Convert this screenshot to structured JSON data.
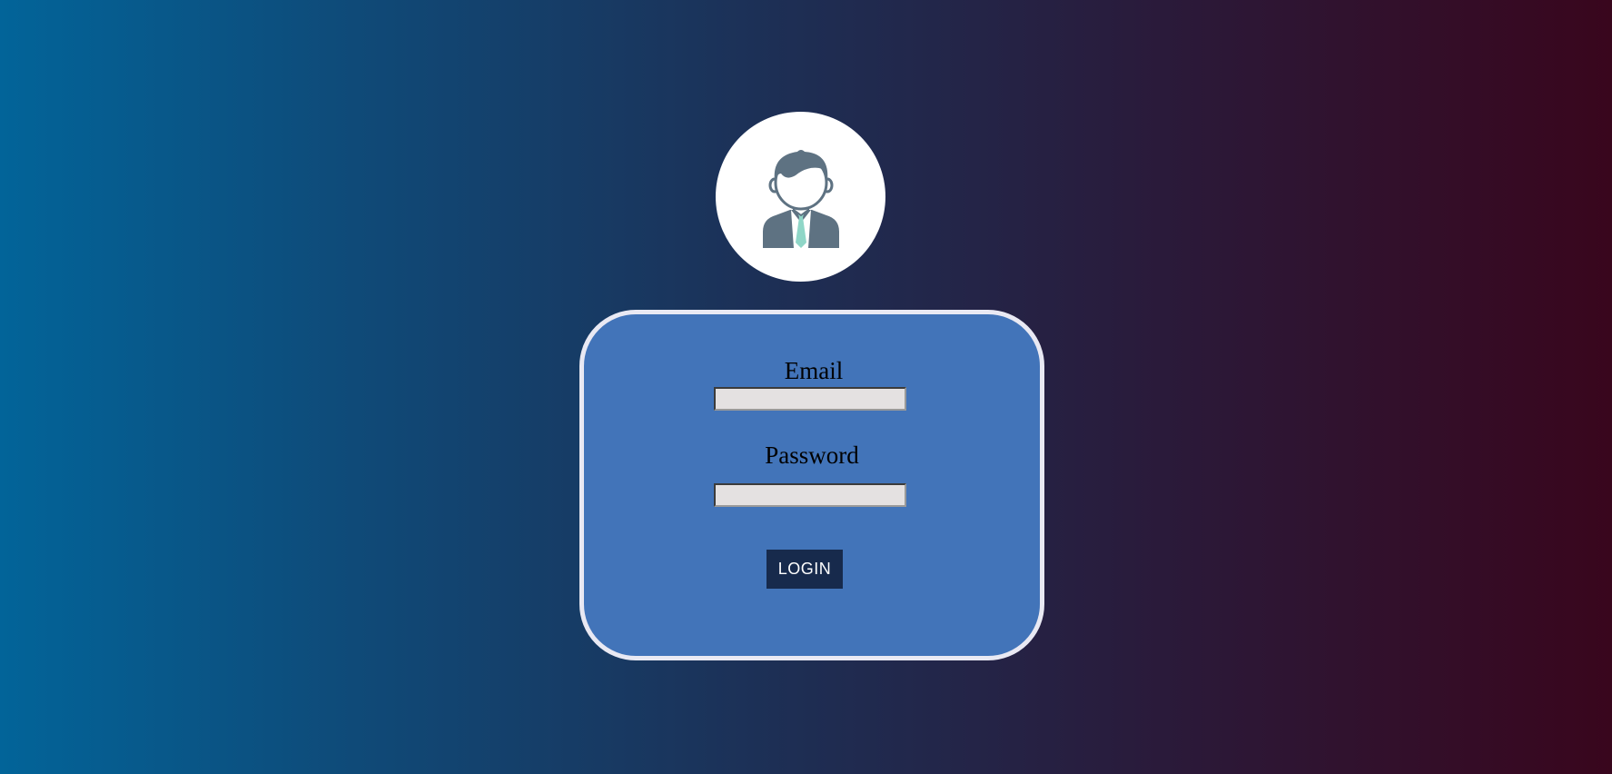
{
  "colors": {
    "card_background": "#4274b9",
    "card_border": "#e9e9f3",
    "button_background": "#172a4c",
    "avatar_background": "#ffffff",
    "avatar_figure": "#5e7282",
    "tie": "#8fd6c7"
  },
  "avatar": {
    "icon": "user-avatar-icon"
  },
  "form": {
    "email_label": "Email",
    "email_value": "",
    "password_label": "Password",
    "password_value": "",
    "login_label": "LOGIN"
  }
}
